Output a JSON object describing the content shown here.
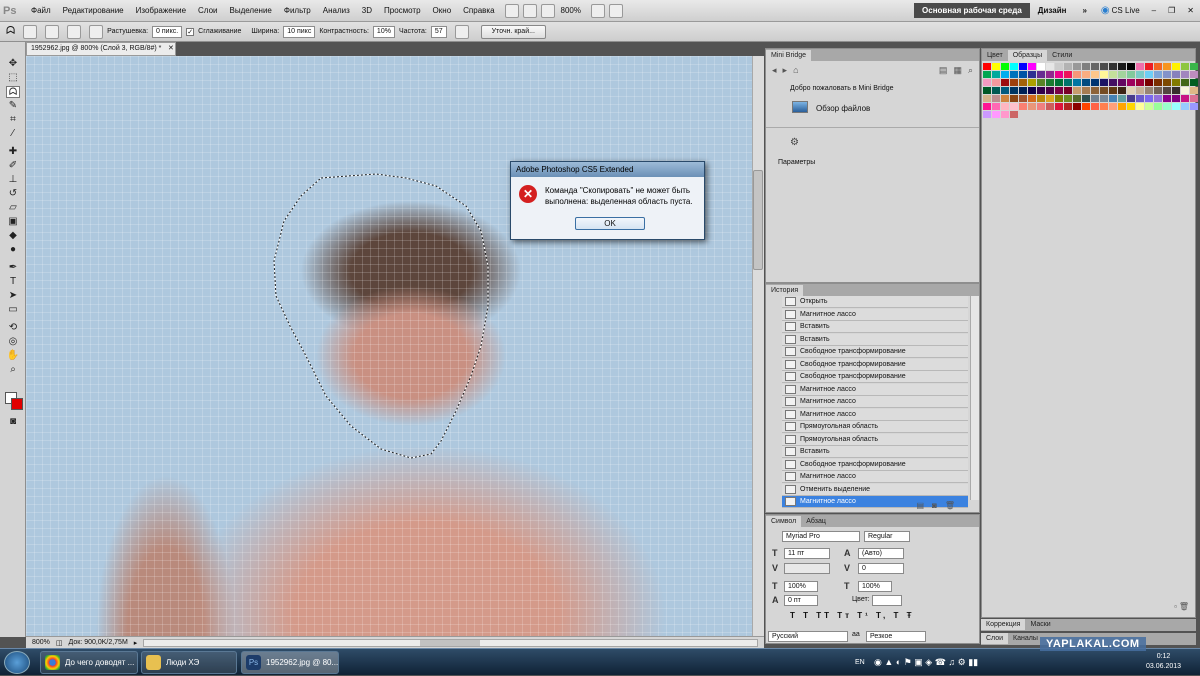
{
  "menubar": {
    "logo": "Ps",
    "items": [
      "Файл",
      "Редактирование",
      "Изображение",
      "Слои",
      "Выделение",
      "Фильтр",
      "Анализ",
      "3D",
      "Просмотр",
      "Окно",
      "Справка"
    ],
    "zoom": "800%",
    "workspace_active": "Основная рабочая среда",
    "workspace_alt": "Дизайн",
    "cslive": "CS Live"
  },
  "options": {
    "feather_label": "Растушевка:",
    "feather_value": "0 пикс.",
    "antialias_label": "Сглаживание",
    "width_label": "Ширина:",
    "width_value": "10 пикс",
    "contrast_label": "Контрастность:",
    "contrast_value": "10%",
    "frequency_label": "Частота:",
    "frequency_value": "57",
    "refine_label": "Уточн. край..."
  },
  "document": {
    "tab_title": "1952962.jpg @ 800% (Слой 3, RGB/8#) *",
    "zoom": "800%",
    "doc_size": "Док: 900,0K/2,75M"
  },
  "dialog": {
    "title": "Adobe Photoshop CS5 Extended",
    "message_line1": "Команда \"Скопировать\" не может быть",
    "message_line2": "выполнена: выделенная область пуста.",
    "ok": "OK"
  },
  "minibridge": {
    "tab": "Mini Bridge",
    "welcome": "Добро пожаловать в Mini Bridge",
    "browse": "Обзор файлов",
    "params": "Параметры"
  },
  "swatches": {
    "tabs": [
      "Цвет",
      "Образцы",
      "Стили"
    ],
    "colors": [
      "#ff0000",
      "#ffff00",
      "#00ff00",
      "#00ffff",
      "#0000ff",
      "#ff00ff",
      "#ffffff",
      "#e6e6e6",
      "#cccccc",
      "#b3b3b3",
      "#999999",
      "#808080",
      "#666666",
      "#4d4d4d",
      "#333333",
      "#1a1a1a",
      "#000000",
      "#f06eaa",
      "#ed1c24",
      "#f26522",
      "#f7941d",
      "#fff200",
      "#8dc63f",
      "#39b54a",
      "#00a651",
      "#00a99d",
      "#00aeef",
      "#0072bc",
      "#0054a6",
      "#2e3192",
      "#662d91",
      "#92278f",
      "#ec008c",
      "#ed145b",
      "#f69679",
      "#f9ad81",
      "#fdc68a",
      "#fff799",
      "#c4df9b",
      "#a3d39c",
      "#82ca9c",
      "#7accc8",
      "#6dcff6",
      "#7da7d9",
      "#8393ca",
      "#8781bd",
      "#a186be",
      "#bd8cbf",
      "#f49ac2",
      "#f6989d",
      "#9e0b0f",
      "#a0410d",
      "#a36209",
      "#aba000",
      "#598527",
      "#1a7b30",
      "#007236",
      "#00746b",
      "#0076a3",
      "#004b80",
      "#003471",
      "#1b1464",
      "#440e62",
      "#630460",
      "#9e005d",
      "#9e0039",
      "#790000",
      "#7b2e00",
      "#7d4900",
      "#827b00",
      "#406618",
      "#005e20",
      "#005826",
      "#005952",
      "#005b7f",
      "#003663",
      "#002157",
      "#0d004c",
      "#32004b",
      "#4b0049",
      "#7b0046",
      "#7a0026",
      "#c69c6d",
      "#a67c52",
      "#8c6239",
      "#754c24",
      "#603913",
      "#3c2415",
      "#e2d4b7",
      "#c7b299",
      "#998675",
      "#736357",
      "#534741",
      "#362f2d",
      "#f5f5dc",
      "#deb887",
      "#d2b48c",
      "#bc8f8f",
      "#cd853f",
      "#8b4513",
      "#a0522d",
      "#d2691e",
      "#b8860b",
      "#daa520",
      "#808000",
      "#6b8e23",
      "#556b2f",
      "#2f4f4f",
      "#708090",
      "#778899",
      "#4682b4",
      "#5f9ea0",
      "#483d8b",
      "#6a5acd",
      "#7b68ee",
      "#9370db",
      "#8b008b",
      "#800080",
      "#c71585",
      "#db7093",
      "#ff1493",
      "#ff69b4",
      "#ffb6c1",
      "#ffc0cb",
      "#fa8072",
      "#e9967a",
      "#f08080",
      "#cd5c5c",
      "#dc143c",
      "#b22222",
      "#8b0000",
      "#ff4500",
      "#ff6347",
      "#ff7f50",
      "#ffa07a",
      "#ffa500",
      "#ffd700",
      "#ffff99",
      "#ccff99",
      "#99ff99",
      "#99ffcc",
      "#99ffff",
      "#99ccff",
      "#9999ff",
      "#cc99ff",
      "#ff99ff",
      "#ff99cc",
      "#cc6666"
    ],
    "adjustments_tabs": [
      "Коррекция",
      "Маски"
    ],
    "layers_tabs": [
      "Слои",
      "Каналы"
    ]
  },
  "history": {
    "tab": "История",
    "items": [
      "Открыть",
      "Магнитное лассо",
      "Вставить",
      "Вставить",
      "Свободное трансформирование",
      "Свободное трансформирование",
      "Свободное трансформирование",
      "Магнитное лассо",
      "Магнитное лассо",
      "Магнитное лассо",
      "Прямоугольная область",
      "Прямоугольная область",
      "Вставить",
      "Свободное трансформирование",
      "Магнитное лассо",
      "Отменить выделение",
      "Магнитное лассо"
    ]
  },
  "character": {
    "tabs": [
      "Символ",
      "Абзац"
    ],
    "font": "Myriad Pro",
    "style": "Regular",
    "size": "11 пт",
    "leading": "(Авто)",
    "tracking": "0",
    "vscale": "100%",
    "hscale": "100%",
    "baseline": "0 пт",
    "color_label": "Цвет:",
    "language": "Русский",
    "aa": "Резкое"
  },
  "taskbar": {
    "items": [
      "До чего доводят ...",
      "Люди ХЭ",
      "1952962.jpg @ 80..."
    ],
    "lang": "EN",
    "clock_time": "0:12",
    "clock_date": "03.06.2013",
    "watermark": "YAPLAKAL.COM"
  }
}
